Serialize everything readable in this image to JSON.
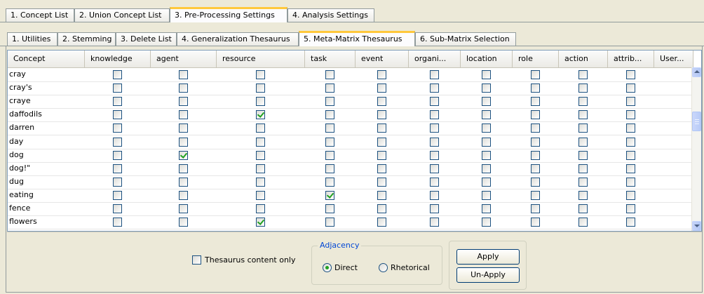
{
  "outer_tabs": [
    {
      "label": "1. Concept List",
      "active": false
    },
    {
      "label": "2. Union Concept List",
      "active": false
    },
    {
      "label": "3. Pre-Processing Settings",
      "active": true
    },
    {
      "label": "4. Analysis Settings",
      "active": false
    }
  ],
  "inner_tabs": [
    {
      "label": "1. Utilities",
      "active": false
    },
    {
      "label": "2. Stemming",
      "active": false
    },
    {
      "label": "3. Delete List",
      "active": false
    },
    {
      "label": "4. Generalization Thesaurus",
      "active": false
    },
    {
      "label": "5. Meta-Matrix Thesaurus",
      "active": true
    },
    {
      "label": "6. Sub-Matrix Selection",
      "active": false
    }
  ],
  "table": {
    "columns": [
      "Concept",
      "knowledge",
      "agent",
      "resource",
      "task",
      "event",
      "organi...",
      "location",
      "role",
      "action",
      "attrib...",
      "User..."
    ],
    "rows": [
      {
        "concept": "cray",
        "checked": []
      },
      {
        "concept": "cray's",
        "checked": []
      },
      {
        "concept": "craye",
        "checked": []
      },
      {
        "concept": "daffodils",
        "checked": [
          "resource"
        ]
      },
      {
        "concept": "darren",
        "checked": []
      },
      {
        "concept": "day",
        "checked": []
      },
      {
        "concept": "dog",
        "checked": [
          "agent"
        ]
      },
      {
        "concept": "dog!\"",
        "checked": []
      },
      {
        "concept": "dug",
        "checked": []
      },
      {
        "concept": "eating",
        "checked": [
          "task"
        ]
      },
      {
        "concept": "fence",
        "checked": []
      },
      {
        "concept": "flowers",
        "checked": [
          "resource"
        ]
      }
    ]
  },
  "controls": {
    "thesaurus_only_label": "Thesaurus content only",
    "thesaurus_only_checked": false,
    "adjacency_legend": "Adjacency",
    "direct_label": "Direct",
    "rhetorical_label": "Rhetorical",
    "selected_adjacency": "Direct",
    "apply_label": "Apply",
    "unapply_label": "Un-Apply"
  },
  "colors": {
    "active_tab_accent": "#ffc83c",
    "check_mark": "#21a121",
    "legend_text": "#0046d5"
  }
}
